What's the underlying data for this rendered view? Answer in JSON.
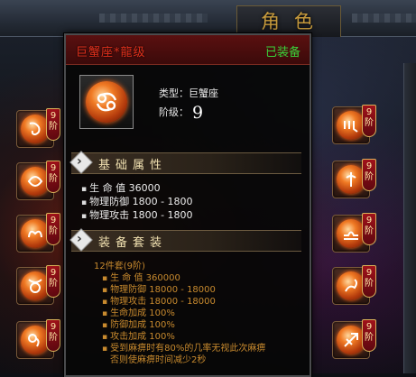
{
  "header": {
    "title": "角色"
  },
  "right_edge": {
    "char_a": "",
    "char_b": ""
  },
  "slots": {
    "badge_text": "9阶",
    "left": [
      "equip-slot-1",
      "equip-slot-2",
      "equip-slot-3",
      "equip-slot-4",
      "equip-slot-5"
    ],
    "right": [
      "equip-slot-6",
      "equip-slot-7",
      "equip-slot-8",
      "equip-slot-9",
      "equip-slot-10"
    ]
  },
  "tooltip": {
    "item_name": "巨蟹座*龍级",
    "status": "已装备",
    "type_label": "类型：巨蟹座",
    "level_label": "阶级：",
    "level_value": "9",
    "base_section": "基础属性",
    "base_attrs": [
      "生 命 值 36000",
      "物理防御 1800 - 1800",
      "物理攻击 1800 - 1800"
    ],
    "set_section": "装备套装",
    "set_title": "12件套(9阶)",
    "set_attrs": [
      "生 命 值 360000",
      "物理防御 18000 - 18000",
      "物理攻击 18000 - 18000",
      "生命加成 100%",
      "防御加成 100%",
      "攻击加成 100%",
      "受到麻痹时有80%的几率无视此次麻痹",
      "否则使麻痹时间减少2秒"
    ]
  },
  "colors": {
    "item_name": "#e0301c",
    "equipped": "#3ad23a",
    "set_text": "#c88a2e",
    "title": "#c69a3c"
  }
}
